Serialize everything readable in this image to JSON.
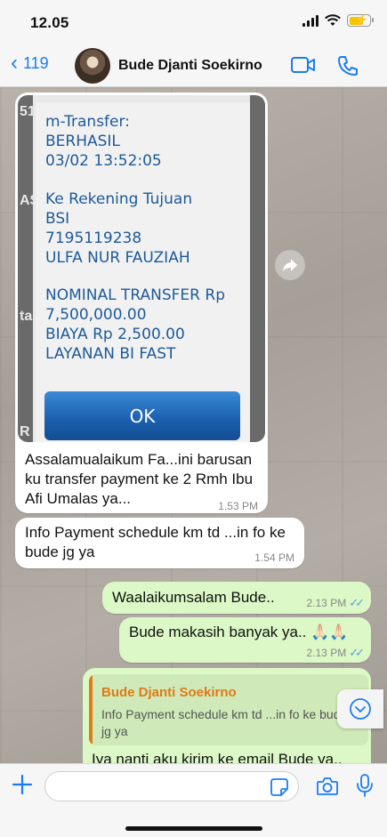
{
  "status_bar": {
    "time": "12.05"
  },
  "header": {
    "back_count": "119",
    "contact_name": "Bude Djanti Soekirno"
  },
  "receipt": {
    "lines": [
      "m-Transfer:",
      "BERHASIL",
      "03/02 13:52:05",
      "",
      "Ke Rekening Tujuan",
      "BSI",
      "7195119238",
      "ULFA NUR FAUZIAH",
      "",
      "NOMINAL TRANSFER Rp",
      "7,500,000.00",
      "BIAYA Rp 2,500.00",
      "LAYANAN BI FAST"
    ],
    "ok_label": "OK"
  },
  "messages": [
    {
      "text": "Assalamualaikum Fa...ini barusan ku transfer payment ke 2 Rmh Ibu Afi Umalas ya...",
      "time": "1.53 PM"
    },
    {
      "text": "Info Payment schedule km td ...in fo ke bude jg ya",
      "time": "1.54 PM"
    },
    {
      "text": "Waalaikumsalam Bude..",
      "time": "2.13 PM"
    },
    {
      "text": "Bude makasih banyak ya.. 🙏🏻🙏🏻",
      "time": "2.13 PM"
    },
    {
      "text": "Iya nanti aku kirim ke email Bude ya..",
      "time": ""
    }
  ],
  "reply": {
    "author": "Bude Djanti Soekirno",
    "snippet": "Info Payment schedule km td ...in fo ke bude jg ya"
  },
  "input": {
    "placeholder": ""
  },
  "colors": {
    "accent": "#1a7cf5",
    "outgoing_bubble": "#dcf8c6",
    "incoming_bubble": "#ffffff",
    "read_ticks": "#4fa3e0",
    "reply_author": "#e07a16"
  }
}
